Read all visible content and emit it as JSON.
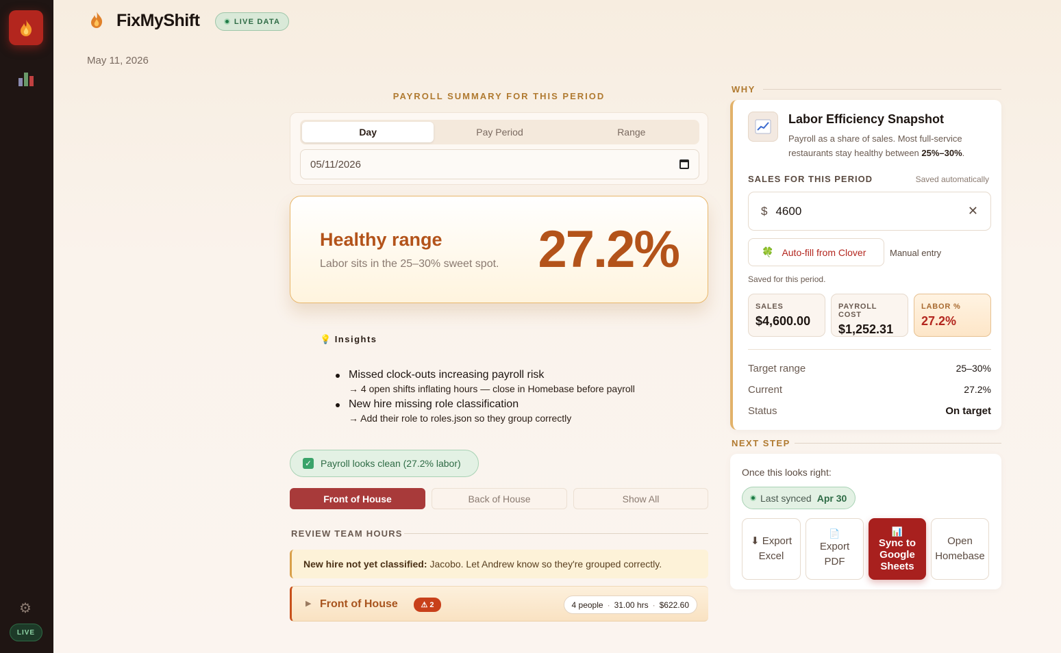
{
  "app": {
    "name": "FixMyShift",
    "live_badge": "LIVE DATA",
    "date": "May 11, 2026"
  },
  "sidebar": {
    "live_label": "LIVE"
  },
  "payroll": {
    "section_title": "PAYROLL SUMMARY FOR THIS PERIOD",
    "tabs": [
      {
        "label": "Day",
        "active": true
      },
      {
        "label": "Pay Period",
        "active": false
      },
      {
        "label": "Range",
        "active": false
      }
    ],
    "date_value": "05/11/2026"
  },
  "health": {
    "title": "Healthy range",
    "subtitle": "Labor sits in the 25–30% sweet spot.",
    "percent": "27.2%"
  },
  "insights": {
    "heading": "Insights",
    "items": [
      {
        "main": "Missed clock-outs increasing payroll risk",
        "sub": "→ 4 open shifts inflating hours — close in Homebase before payroll"
      },
      {
        "main": "New hire missing role classification",
        "sub": "→ Add their role to roles.json so they group correctly"
      }
    ]
  },
  "clean_status": "Payroll looks clean (27.2% labor)",
  "filters": [
    {
      "label": "Front of House",
      "active": true
    },
    {
      "label": "Back of House",
      "active": false
    },
    {
      "label": "Show All",
      "active": false
    }
  ],
  "review": {
    "heading": "REVIEW TEAM HOURS",
    "warning_bold": "New hire not yet classified:",
    "warning_text": "Jacobo. Let Andrew know so they're grouped correctly.",
    "group": {
      "label": "Front of House",
      "alert_count": "2",
      "people": "4 people",
      "hours": "31.00 hrs",
      "cost": "$622.60"
    }
  },
  "why": {
    "heading": "WHY",
    "title": "Labor Efficiency Snapshot",
    "desc_prefix": "Payroll as a share of sales. Most full-service restaurants stay healthy between ",
    "desc_range": "25%–30%",
    "desc_suffix": ".",
    "sales_heading": "SALES FOR THIS PERIOD",
    "saved_auto": "Saved automatically",
    "currency": "$",
    "sales_value": "4600",
    "clover_label": "Auto-fill from Clover",
    "manual_label": "Manual entry",
    "saved_period": "Saved for this period.",
    "stats": [
      {
        "label": "SALES",
        "value": "$4,600.00"
      },
      {
        "label": "PAYROLL COST",
        "value": "$1,252.31"
      },
      {
        "label": "LABOR %",
        "value": "27.2%"
      }
    ],
    "rows": [
      {
        "key": "Target range",
        "value": "25–30%"
      },
      {
        "key": "Current",
        "value": "27.2%"
      },
      {
        "key": "Status",
        "value": "On target"
      }
    ]
  },
  "next_step": {
    "heading": "NEXT STEP",
    "once": "Once this looks right:",
    "sync_label": "Last synced",
    "sync_date": "Apr 30",
    "actions": {
      "export_excel": {
        "icon": "⬇",
        "line1": "Export",
        "line2": "Excel"
      },
      "export_pdf": {
        "icon": "📄",
        "line1": "Export",
        "line2": "PDF"
      },
      "sync_sheets": {
        "icon": "📊",
        "line1": "Sync to",
        "line2": "Google",
        "line3": "Sheets"
      },
      "open_homebase": {
        "line1": "Open",
        "line2": "Homebase"
      }
    }
  },
  "colors": {
    "accent": "#b3261e",
    "healthy": "#b3531a",
    "success": "#2e6b45",
    "sidebar": "#1f1513"
  }
}
